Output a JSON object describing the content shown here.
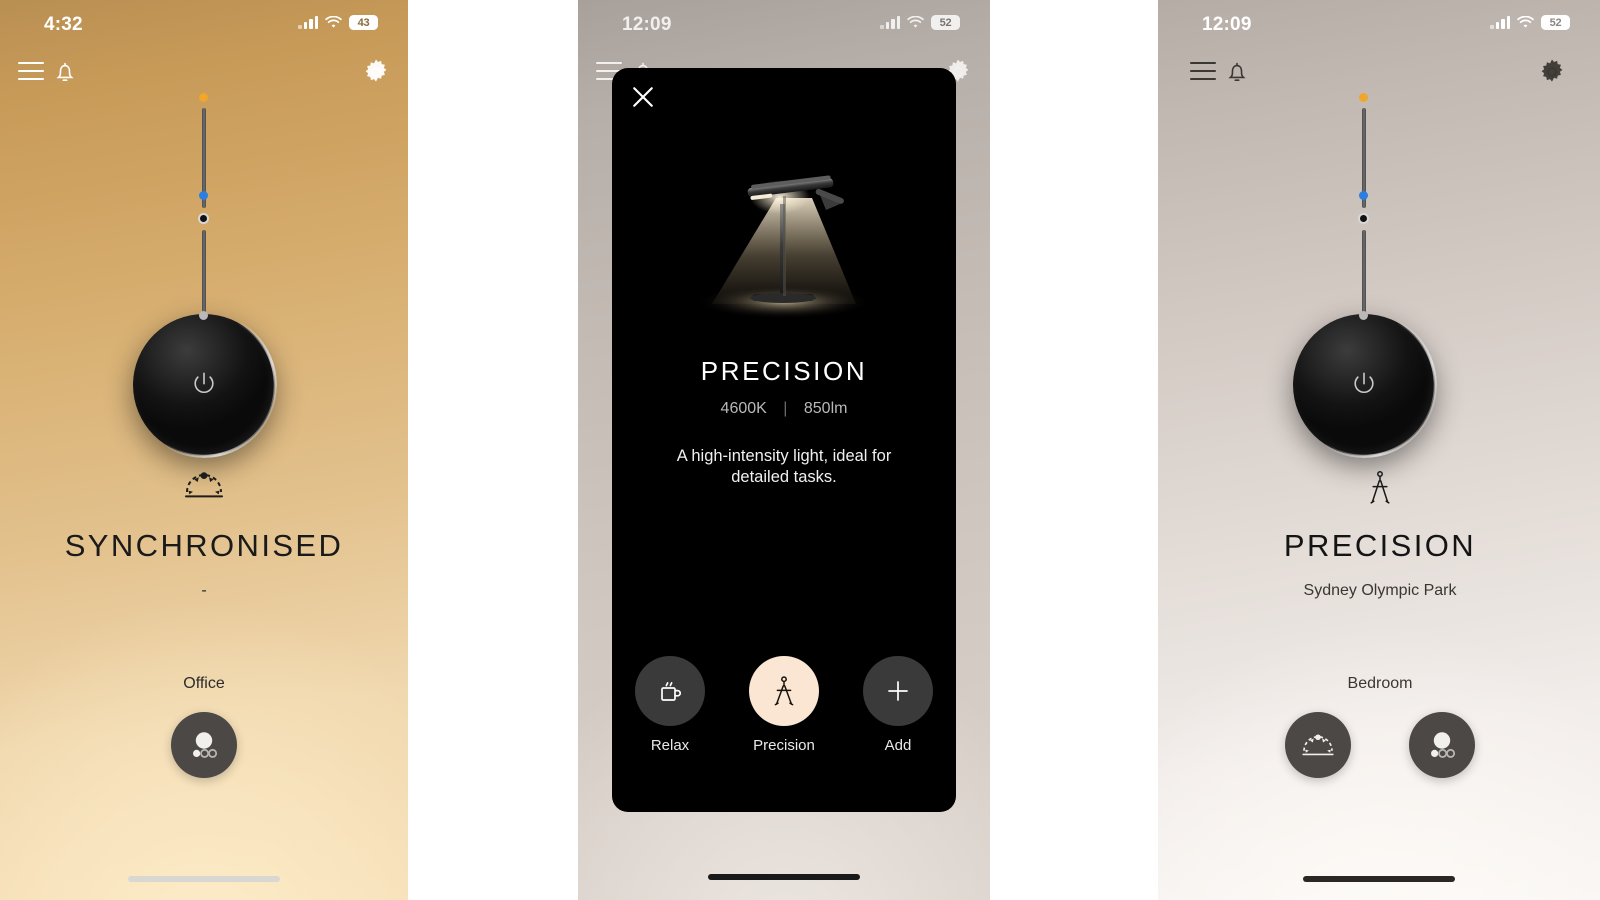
{
  "theme": {
    "gold": "#d5ab6b",
    "taupe": "#cfc6bf",
    "cream_accent": "#fbe6d3",
    "dark_knob": "#141414",
    "tick_warm": "#f0a52b",
    "tick_cool": "#2b7fe0",
    "room_button_bg": "#4b4845"
  },
  "panels": [
    {
      "id": "panel-synchronised",
      "status": {
        "time": "4:32",
        "battery": "43",
        "signal_bars": 4,
        "wifi": "wifi-icon"
      },
      "nav": {
        "menu": "menu-icon",
        "bell": "bell-icon",
        "settings": "gear-icon"
      },
      "mode": {
        "icon": "synchronised-icon",
        "title": "SYNCHRONISED",
        "subtitle": "-"
      },
      "room": {
        "label": "Office"
      },
      "room_buttons": [
        {
          "name": "office",
          "icon": "moon-dots-icon",
          "active": true
        }
      ],
      "slider": {
        "warm_tick": "warm-temperature-tick",
        "cool_tick": "cool-temperature-tick",
        "ring_marker": "brightness-ring-marker",
        "bottom_tick": "brightness-level-tick"
      },
      "power_button": "power-icon"
    },
    {
      "id": "panel-precision-modal",
      "status": {
        "time": "12:09",
        "battery": "52",
        "signal_bars": 4,
        "wifi": "wifi-icon"
      },
      "nav": {
        "menu": "menu-icon",
        "bell": "bell-icon",
        "settings": "gear-icon"
      },
      "modal": {
        "close": "close-icon",
        "hero": "desk-lamp-image",
        "title": "PRECISION",
        "temperature": "4600K",
        "separator": "|",
        "lumens": "850lm",
        "description": "A high-intensity light, ideal for detailed tasks.",
        "presets": [
          {
            "label": "Relax",
            "icon": "coffee-mug-icon",
            "active": false
          },
          {
            "label": "Precision",
            "icon": "compass-divider-icon",
            "active": true
          },
          {
            "label": "Add",
            "icon": "plus-icon",
            "active": false
          }
        ]
      }
    },
    {
      "id": "panel-precision-applied",
      "status": {
        "time": "12:09",
        "battery": "52",
        "signal_bars": 4,
        "wifi": "wifi-icon"
      },
      "nav": {
        "menu": "menu-icon",
        "bell": "bell-icon",
        "settings": "gear-icon"
      },
      "mode": {
        "icon": "compass-divider-icon",
        "title": "PRECISION",
        "subtitle": "Sydney Olympic Park"
      },
      "room": {
        "label": "Bedroom"
      },
      "room_buttons": [
        {
          "name": "synchronised",
          "icon": "synchronised-icon",
          "active": false
        },
        {
          "name": "office",
          "icon": "moon-dots-icon",
          "active": false
        }
      ],
      "slider": {
        "warm_tick": "warm-temperature-tick",
        "cool_tick": "cool-temperature-tick",
        "ring_marker": "brightness-ring-marker",
        "bottom_tick": "brightness-level-tick"
      },
      "power_button": "power-icon"
    }
  ]
}
